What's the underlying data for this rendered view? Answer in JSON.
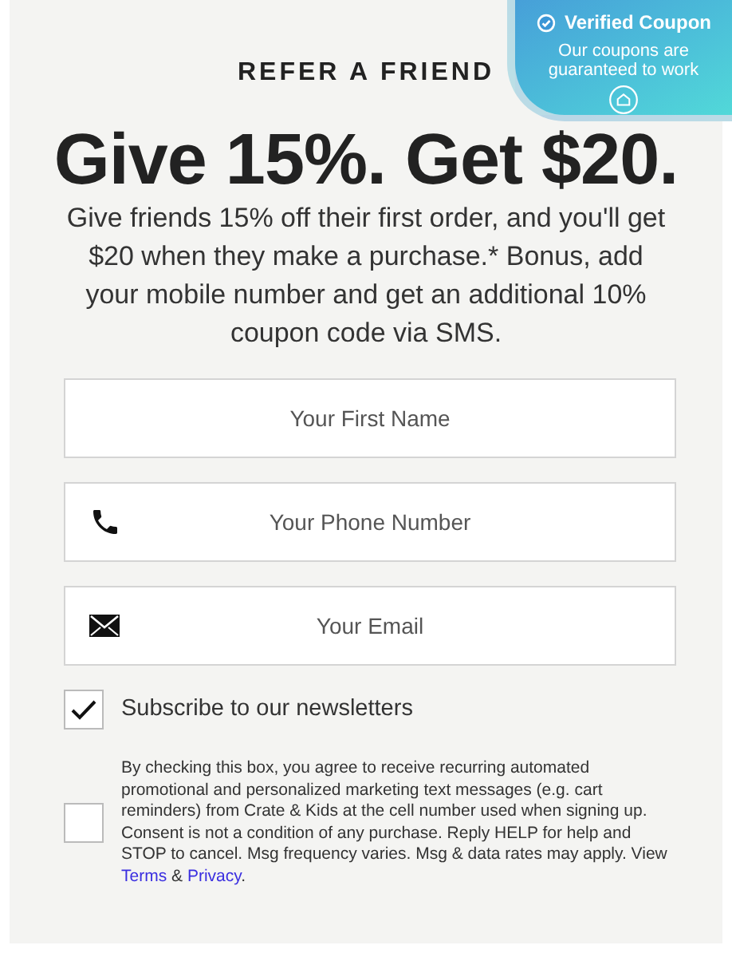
{
  "badge": {
    "title": "Verified Coupon",
    "text": "Our coupons are guaranteed to work"
  },
  "eyebrow": "REFER A FRIEND",
  "headline": "Give 15%. Get $20.",
  "description": "Give friends 15% off their first order, and you'll get $20 when they make a purchase.* Bonus, add your mobile number and get an additional 10% coupon code via SMS.",
  "fields": [
    {
      "kind": "text",
      "placeholder": "Your First Name"
    },
    {
      "kind": "phone",
      "placeholder": "Your Phone Number"
    },
    {
      "kind": "email",
      "placeholder": "Your Email"
    }
  ],
  "newsletter": {
    "label": "Subscribe to our newsletters",
    "checked": true
  },
  "sms_consent": {
    "checked": false,
    "segments": [
      {
        "kind": "text",
        "text": "By checking this box, you agree to receive recurring automated promotional and personalized marketing text messages (e.g. cart reminders) from Crate & Kids at the cell number used when signing up. Consent is not a condition of any purchase. Reply HELP for help and STOP to cancel. Msg frequency varies. Msg & data rates may apply. View "
      },
      {
        "kind": "link",
        "text": "Terms"
      },
      {
        "kind": "text",
        "text": " & "
      },
      {
        "kind": "link",
        "text": "Privacy"
      },
      {
        "kind": "text",
        "text": "."
      }
    ]
  }
}
